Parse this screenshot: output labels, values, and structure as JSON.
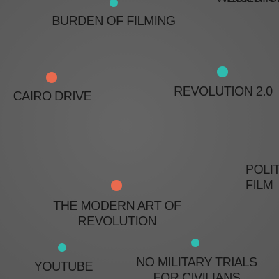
{
  "colors": {
    "background": "#606060",
    "teal": "#2fbcb0",
    "coral": "#ea6a4e",
    "label": "#161616"
  },
  "nodes": [
    {
      "id": "burden-of-filming",
      "label": "BURDEN OF FILMING",
      "color": "teal"
    },
    {
      "id": "building",
      "label": "BUILDIN",
      "color": "none"
    },
    {
      "id": "cairo-drive",
      "label": "CAIRO DRIVE",
      "color": "coral"
    },
    {
      "id": "revolution-2-0",
      "label": "REVOLUTION 2.0",
      "color": "teal"
    },
    {
      "id": "political-film",
      "label": "POLIT\nFILM",
      "color": "none"
    },
    {
      "id": "modern-art-of-revolution",
      "label": "THE MODERN ART OF\nREVOLUTION",
      "color": "coral"
    },
    {
      "id": "youtube",
      "label": "YOUTUBE",
      "color": "teal"
    },
    {
      "id": "no-military-trials",
      "label": "NO MILITARY TRIALS\nFOR CIVILIANS",
      "color": "teal"
    }
  ]
}
